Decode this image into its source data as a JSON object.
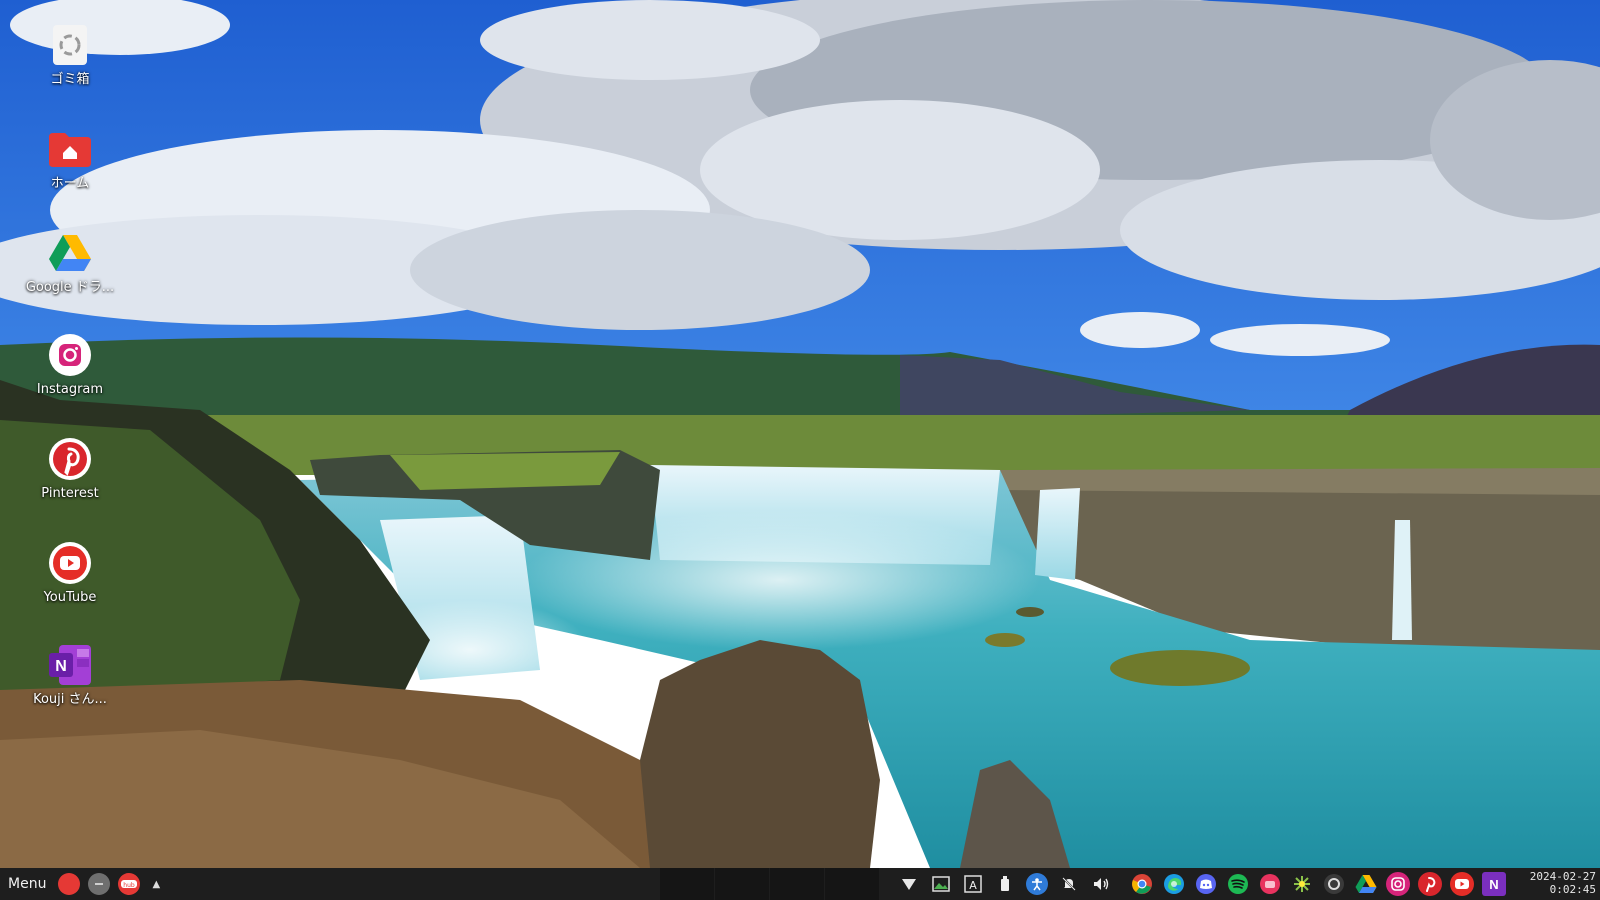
{
  "desktop": {
    "icons": [
      {
        "label": "ゴミ箱",
        "icon": "trash-icon"
      },
      {
        "label": "ホーム",
        "icon": "home-folder-icon"
      },
      {
        "label": "Google ドラ...",
        "icon": "google-drive-icon"
      },
      {
        "label": "Instagram",
        "icon": "instagram-icon"
      },
      {
        "label": "Pinterest",
        "icon": "pinterest-icon"
      },
      {
        "label": "YouTube",
        "icon": "youtube-icon"
      },
      {
        "label": "Kouji さん...",
        "icon": "onenote-icon"
      }
    ]
  },
  "taskbar": {
    "menu_label": "Menu",
    "clock_date": "2024-02-27",
    "clock_time": "0:02:45",
    "colors": {
      "bar": "#1e1e1e",
      "red": "#e53935"
    },
    "launcher_icons": [
      "red-app-icon",
      "gray-app-icon",
      "hub-icon",
      "chevron-up-icon"
    ],
    "tray_icons": [
      "wifi-icon",
      "image-viewer-icon",
      "input-method-icon",
      "usb-icon",
      "accessibility-icon",
      "notifications-muted-icon",
      "volume-icon"
    ],
    "app_icons": [
      "chrome-icon",
      "edge-icon",
      "discord-icon",
      "spotify-icon",
      "red-pink-app-icon",
      "app-grid-icon",
      "circle-app-icon",
      "google-drive-icon",
      "instagram-icon",
      "pinterest-icon",
      "youtube-icon",
      "onenote-icon"
    ]
  }
}
